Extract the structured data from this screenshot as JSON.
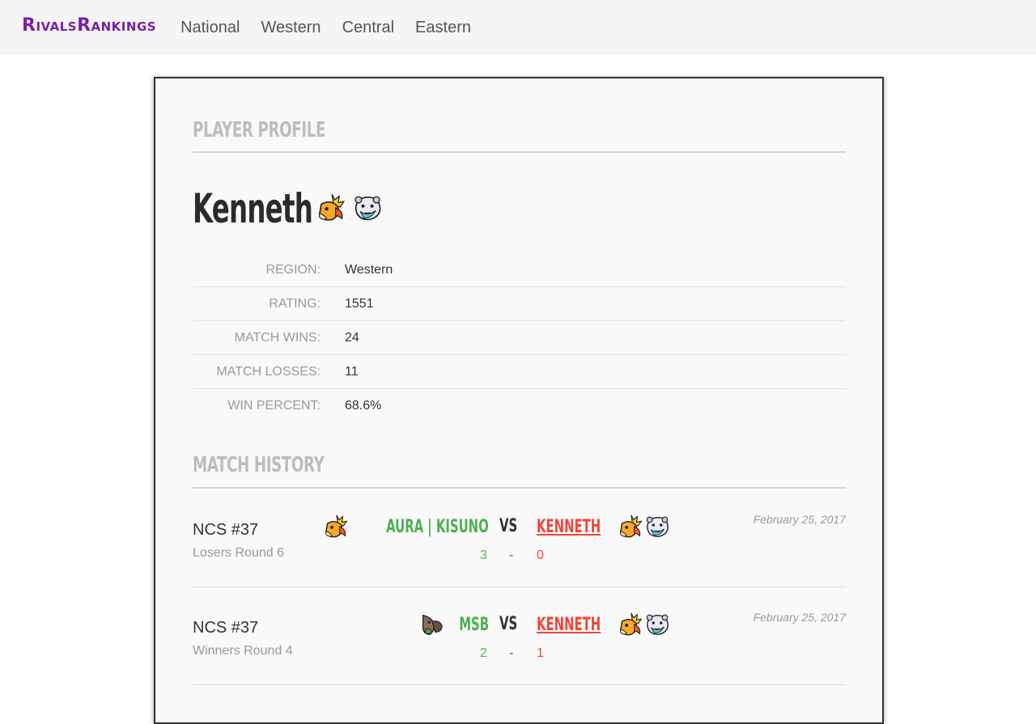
{
  "nav": {
    "brand": "RivalsRankings",
    "links": [
      "National",
      "Western",
      "Central",
      "Eastern"
    ]
  },
  "profile": {
    "section_title": "Player Profile",
    "player_name": "Kenneth",
    "character_icons": [
      "zetterburn-icon",
      "etalus-icon"
    ],
    "stats": [
      {
        "label": "REGION:",
        "value": "Western"
      },
      {
        "label": "RATING:",
        "value": "1551"
      },
      {
        "label": "MATCH WINS:",
        "value": "24"
      },
      {
        "label": "MATCH LOSSES:",
        "value": "11"
      },
      {
        "label": "WIN PERCENT:",
        "value": "68.6%"
      }
    ]
  },
  "history": {
    "section_title": "Match History",
    "vs_label": "VS",
    "dash": "-",
    "matches": [
      {
        "event": "NCS #37",
        "round": "Losers Round 6",
        "date": "February 25, 2017",
        "player1": "AURA | KISUNO",
        "player1_icons": [
          "zetterburn-icon"
        ],
        "player2": "KENNETH",
        "player2_icons": [
          "zetterburn-icon",
          "etalus-icon"
        ],
        "score1": "3",
        "score2": "0"
      },
      {
        "event": "NCS #37",
        "round": "Winners Round 4",
        "date": "February 25, 2017",
        "player1": "MSB",
        "player1_icons": [
          "maypul-icon"
        ],
        "player2": "KENNETH",
        "player2_icons": [
          "zetterburn-icon",
          "etalus-icon"
        ],
        "score1": "2",
        "score2": "1"
      }
    ]
  },
  "colors": {
    "brand": "#7b1fa2",
    "winner": "#4caf50",
    "loser": "#f44336"
  }
}
